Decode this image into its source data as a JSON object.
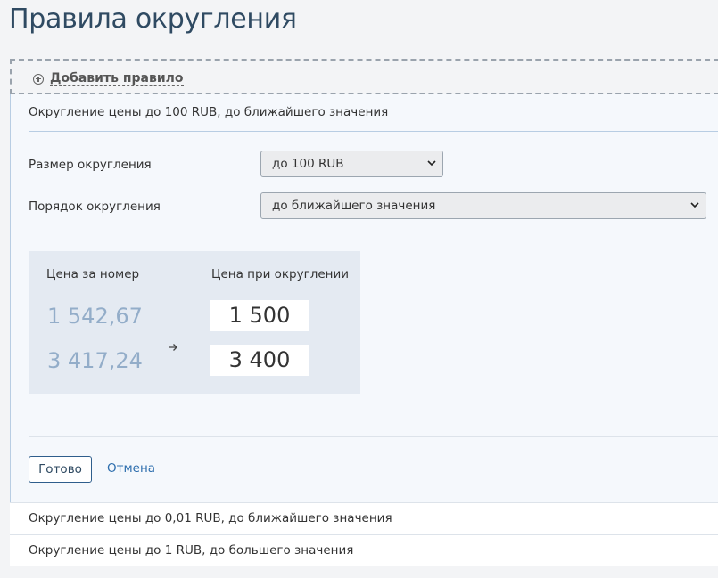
{
  "page": {
    "title": "Правила округления"
  },
  "add_rule": {
    "label": "Добавить правило",
    "icon": "plus-circle-icon"
  },
  "editor": {
    "header": "Округление цены до 100 RUB, до ближайшего значения",
    "size": {
      "label": "Размер округления",
      "value": "до 100 RUB"
    },
    "order": {
      "label": "Порядок округления",
      "value": "до ближайшего значения"
    },
    "preview": {
      "col_original": "Цена за номер",
      "col_rounded": "Цена при округлении",
      "rows": [
        {
          "original": "1 542,67",
          "rounded": "1 500"
        },
        {
          "original": "3 417,24",
          "rounded": "3 400"
        }
      ]
    },
    "done_label": "Готово",
    "cancel_label": "Отмена"
  },
  "rules": [
    {
      "label": "Округление цены до 0,01 RUB, до ближайшего значения"
    },
    {
      "label": "Округление цены до 1 RUB, до большего значения"
    }
  ]
}
